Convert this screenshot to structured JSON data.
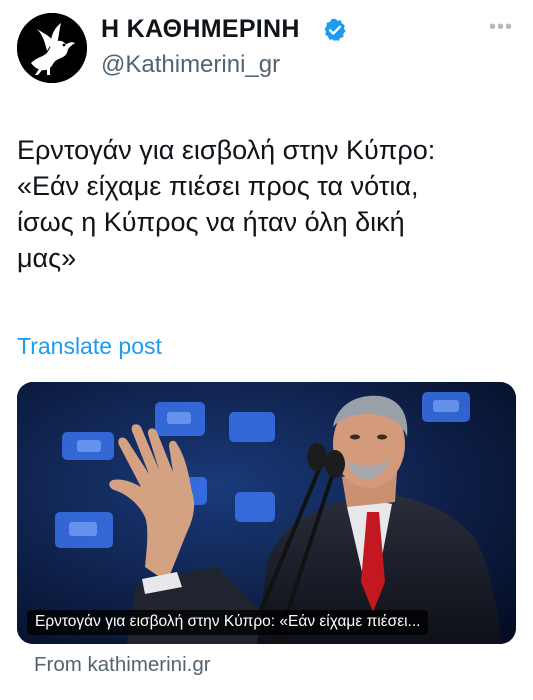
{
  "account": {
    "display_name": "Η ΚΑΘΗΜΕΡΙΝΗ",
    "handle": "@Kathimerini_gr",
    "verified_color": "#1d9bf0"
  },
  "tweet": {
    "text_lines": [
      "Ερντογάν για εισβολή στην Κύπρο:",
      "«Εάν είχαμε πιέσει προς τα νότια,",
      "ίσως η Κύπρος να ήταν όλη δική",
      "μας»"
    ],
    "translate_label": "Translate post"
  },
  "card": {
    "caption": "Ερντογάν για εισβολή στην Κύπρο: «Εάν είχαμε πιέσει...",
    "source": "From kathimerini.gr"
  },
  "icons": {
    "more": "more-options-icon",
    "verified": "verified-badge-icon",
    "avatar": "pegasus-logo"
  },
  "colors": {
    "link": "#1d9bf0",
    "secondary_text": "#536471",
    "primary_text": "#0f1419"
  }
}
